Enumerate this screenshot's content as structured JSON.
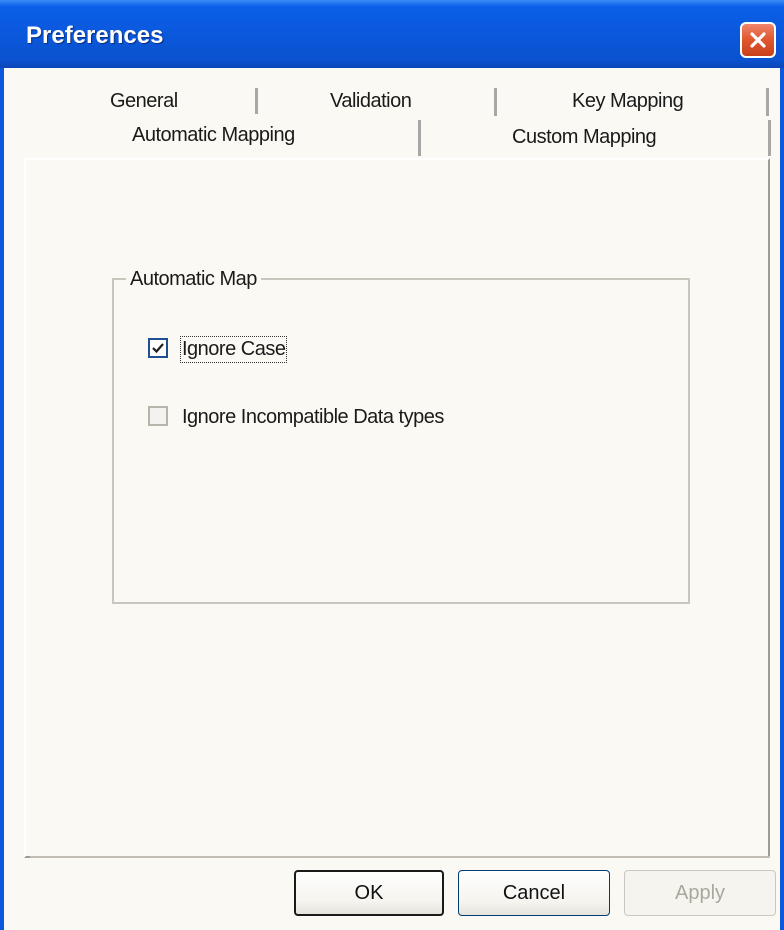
{
  "window": {
    "title": "Preferences",
    "close_icon": "close-icon"
  },
  "tabs": {
    "row1": [
      "General",
      "Validation",
      "Key Mapping"
    ],
    "row2": [
      "Automatic Mapping",
      "Custom Mapping"
    ],
    "active": "Automatic Mapping"
  },
  "group": {
    "label": "Automatic Map",
    "options": [
      {
        "label": "Ignore Case",
        "checked": true
      },
      {
        "label": "Ignore Incompatible Data types",
        "checked": false
      }
    ]
  },
  "buttons": {
    "ok": "OK",
    "cancel": "Cancel",
    "apply": "Apply",
    "apply_enabled": false
  },
  "colors": {
    "titlebar": "#0b58dc",
    "close": "#e15a32",
    "dialog_bg": "#fbf9f3"
  }
}
